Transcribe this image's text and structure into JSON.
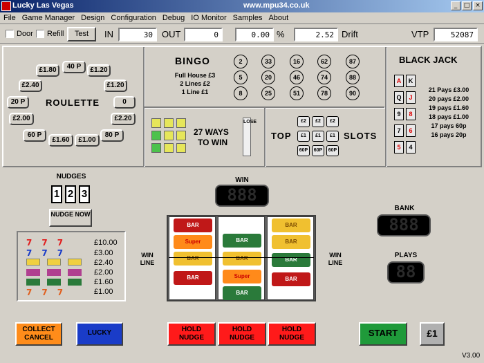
{
  "window": {
    "title": "Lucky Las Vegas",
    "url": "www.mpu34.co.uk",
    "min": "_",
    "max": "□",
    "close": "×"
  },
  "menu": [
    "File",
    "Game Manager",
    "Design",
    "Configuration",
    "Debug",
    "IO Monitor",
    "Samples",
    "About"
  ],
  "toolbar": {
    "door": "Door",
    "refill": "Refill",
    "test": "Test",
    "in_label": "IN",
    "in_value": "30",
    "out_label": "OUT",
    "out_value": "0",
    "pct_value": "0.00",
    "pct_label": "%",
    "drift_value": "2.52",
    "drift_label": "Drift",
    "vtp_label": "VTP",
    "vtp_value": "52087"
  },
  "roulette": {
    "title": "ROULETTE",
    "buttons": [
      "40 P",
      "£1.80",
      "£1.20",
      "£2.40",
      "£1.20",
      "20 P",
      "0",
      "£2.00",
      "£2.20",
      "60 P",
      "£1.60",
      "£1.00",
      "80 P"
    ]
  },
  "bingo": {
    "title": "BINGO",
    "prizes": [
      "Full House £3",
      "2 Lines £2",
      "1 Line £1"
    ],
    "balls": [
      "2",
      "33",
      "16",
      "62",
      "87",
      "5",
      "20",
      "46",
      "74",
      "88",
      "8",
      "25",
      "51",
      "78",
      "90"
    ]
  },
  "ways": {
    "line1": "27 WAYS",
    "line2": "TO WIN",
    "lose": "LOSE"
  },
  "slots": {
    "top": "TOP",
    "label": "SLOTS",
    "cells": [
      "£2",
      "£2",
      "£2",
      "£1",
      "£1",
      "£1",
      "60P",
      "60P",
      "60P"
    ]
  },
  "blackjack": {
    "title": "BLACK JACK",
    "cards": [
      "A",
      "K",
      "Q",
      "J",
      "9",
      "8",
      "7",
      "6",
      "5",
      "4"
    ],
    "pays": [
      "21 Pays £3.00",
      "20 pays £2.00",
      "19 pays £1.60",
      "18 pays £1.00",
      "17 pays 60p",
      "16 pays 20p"
    ]
  },
  "nudges": {
    "title": "NUDGES",
    "numbers": [
      "1",
      "2",
      "3"
    ],
    "nudge_now": "NUDGE NOW"
  },
  "paytable": {
    "rows": [
      {
        "symbol": "777",
        "value": "£10.00"
      },
      {
        "symbol": "sevens",
        "value": "£3.00"
      },
      {
        "symbol": "bells",
        "value": "£2.40"
      },
      {
        "symbol": "bars-pink",
        "value": "£2.00"
      },
      {
        "symbol": "bars-green",
        "value": "£1.60"
      },
      {
        "symbol": "super7",
        "value": "£1.00"
      }
    ]
  },
  "reels": {
    "win": "WIN",
    "win_line_left": "WIN LINE",
    "win_line_right": "WIN LINE",
    "win_display": "888",
    "bank": "BANK",
    "bank_display": "888",
    "plays": "PLAYS",
    "plays_display": "88",
    "symbols": [
      "BAR",
      "Super",
      "BAR",
      "BAR",
      "BAR",
      "BAR",
      "Super",
      "BAR",
      "BAR",
      "BAR",
      "BAR",
      "BAR"
    ]
  },
  "buttons": {
    "collect": "COLLECT CANCEL",
    "lucky": "LUCKY",
    "hold1": "HOLD NUDGE",
    "hold2": "HOLD NUDGE",
    "hold3": "HOLD NUDGE",
    "start": "START",
    "pound": "£1"
  },
  "version": "V3.00",
  "colors": {
    "collect": "#ff8c1a",
    "lucky": "#1a3cc8",
    "hold": "#ff1a1a",
    "start": "#1f9a3a",
    "pound": "#b0b0b0"
  }
}
